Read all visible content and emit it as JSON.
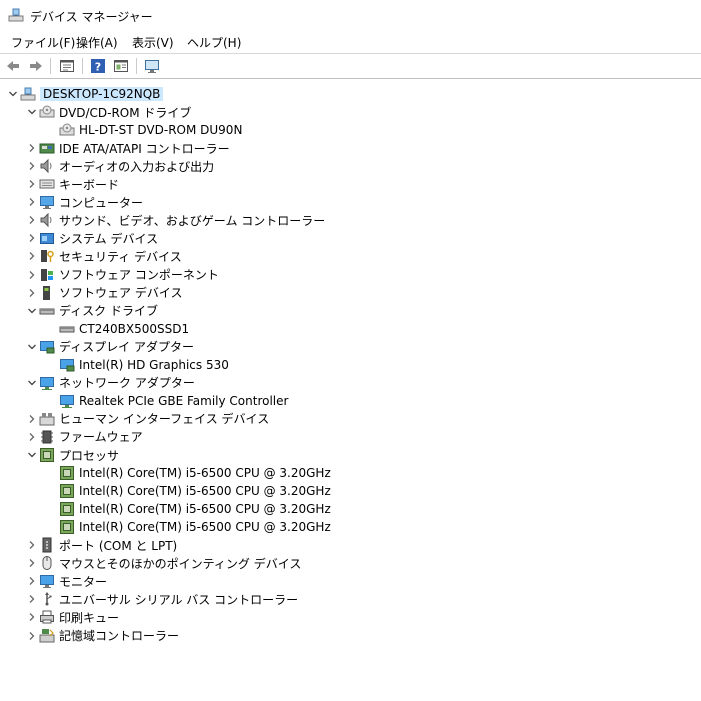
{
  "window": {
    "title": "デバイス マネージャー"
  },
  "menu": [
    "ファイル(F)",
    "操作(A)",
    "表示(V)",
    "ヘルプ(H)"
  ],
  "toolbar": {
    "buttons": [
      {
        "name": "back-button",
        "icon": "back-arrow-icon"
      },
      {
        "name": "forward-button",
        "icon": "forward-arrow-icon"
      },
      {
        "name": "properties-button",
        "icon": "properties-icon"
      },
      {
        "name": "help-button",
        "icon": "help-icon"
      },
      {
        "name": "view-button",
        "icon": "view-icon"
      },
      {
        "name": "scan-hardware-button",
        "icon": "monitor-icon"
      }
    ]
  },
  "tree": {
    "root": "DESKTOP-1C92NQB",
    "items": [
      {
        "label": "DVD/CD-ROM ドライブ",
        "level": 1,
        "expanded": true,
        "icon": "dvd-icon"
      },
      {
        "label": "HL-DT-ST DVD-ROM DU90N",
        "level": 2,
        "icon": "dvd-icon"
      },
      {
        "label": "IDE ATA/ATAPI コントローラー",
        "level": 1,
        "expanded": false,
        "icon": "ide-controller-icon"
      },
      {
        "label": "オーディオの入力および出力",
        "level": 1,
        "expanded": false,
        "icon": "speaker-icon"
      },
      {
        "label": "キーボード",
        "level": 1,
        "expanded": false,
        "icon": "keyboard-icon"
      },
      {
        "label": "コンピューター",
        "level": 1,
        "expanded": false,
        "icon": "computer-icon"
      },
      {
        "label": "サウンド、ビデオ、およびゲーム コントローラー",
        "level": 1,
        "expanded": false,
        "icon": "speaker-icon"
      },
      {
        "label": "システム デバイス",
        "level": 1,
        "expanded": false,
        "icon": "system-folder-icon"
      },
      {
        "label": "セキュリティ デバイス",
        "level": 1,
        "expanded": false,
        "icon": "security-key-icon"
      },
      {
        "label": "ソフトウェア コンポーネント",
        "level": 1,
        "expanded": false,
        "icon": "software-component-icon"
      },
      {
        "label": "ソフトウェア デバイス",
        "level": 1,
        "expanded": false,
        "icon": "software-device-icon"
      },
      {
        "label": "ディスク ドライブ",
        "level": 1,
        "expanded": true,
        "icon": "disk-drive-icon"
      },
      {
        "label": "CT240BX500SSD1",
        "level": 2,
        "icon": "disk-drive-icon"
      },
      {
        "label": "ディスプレイ アダプター",
        "level": 1,
        "expanded": true,
        "icon": "display-adapter-icon"
      },
      {
        "label": "Intel(R) HD Graphics 530",
        "level": 2,
        "icon": "display-adapter-icon"
      },
      {
        "label": "ネットワーク アダプター",
        "level": 1,
        "expanded": true,
        "icon": "network-adapter-icon"
      },
      {
        "label": "Realtek PCIe GBE Family Controller",
        "level": 2,
        "icon": "network-adapter-icon"
      },
      {
        "label": "ヒューマン インターフェイス デバイス",
        "level": 1,
        "expanded": false,
        "icon": "hid-icon"
      },
      {
        "label": "ファームウェア",
        "level": 1,
        "expanded": false,
        "icon": "firmware-icon"
      },
      {
        "label": "プロセッサ",
        "level": 1,
        "expanded": true,
        "icon": "processor-icon"
      },
      {
        "label": "Intel(R) Core(TM) i5-6500 CPU @ 3.20GHz",
        "level": 2,
        "icon": "processor-icon"
      },
      {
        "label": "Intel(R) Core(TM) i5-6500 CPU @ 3.20GHz",
        "level": 2,
        "icon": "processor-icon"
      },
      {
        "label": "Intel(R) Core(TM) i5-6500 CPU @ 3.20GHz",
        "level": 2,
        "icon": "processor-icon"
      },
      {
        "label": "Intel(R) Core(TM) i5-6500 CPU @ 3.20GHz",
        "level": 2,
        "icon": "processor-icon"
      },
      {
        "label": "ポート (COM と LPT)",
        "level": 1,
        "expanded": false,
        "icon": "port-icon"
      },
      {
        "label": "マウスとそのほかのポインティング デバイス",
        "level": 1,
        "expanded": false,
        "icon": "mouse-icon"
      },
      {
        "label": "モニター",
        "level": 1,
        "expanded": false,
        "icon": "monitor-icon"
      },
      {
        "label": "ユニバーサル シリアル バス コントローラー",
        "level": 1,
        "expanded": false,
        "icon": "usb-icon"
      },
      {
        "label": "印刷キュー",
        "level": 1,
        "expanded": false,
        "icon": "printer-icon"
      },
      {
        "label": "記憶域コントローラー",
        "level": 1,
        "expanded": false,
        "icon": "storage-controller-icon"
      }
    ]
  }
}
